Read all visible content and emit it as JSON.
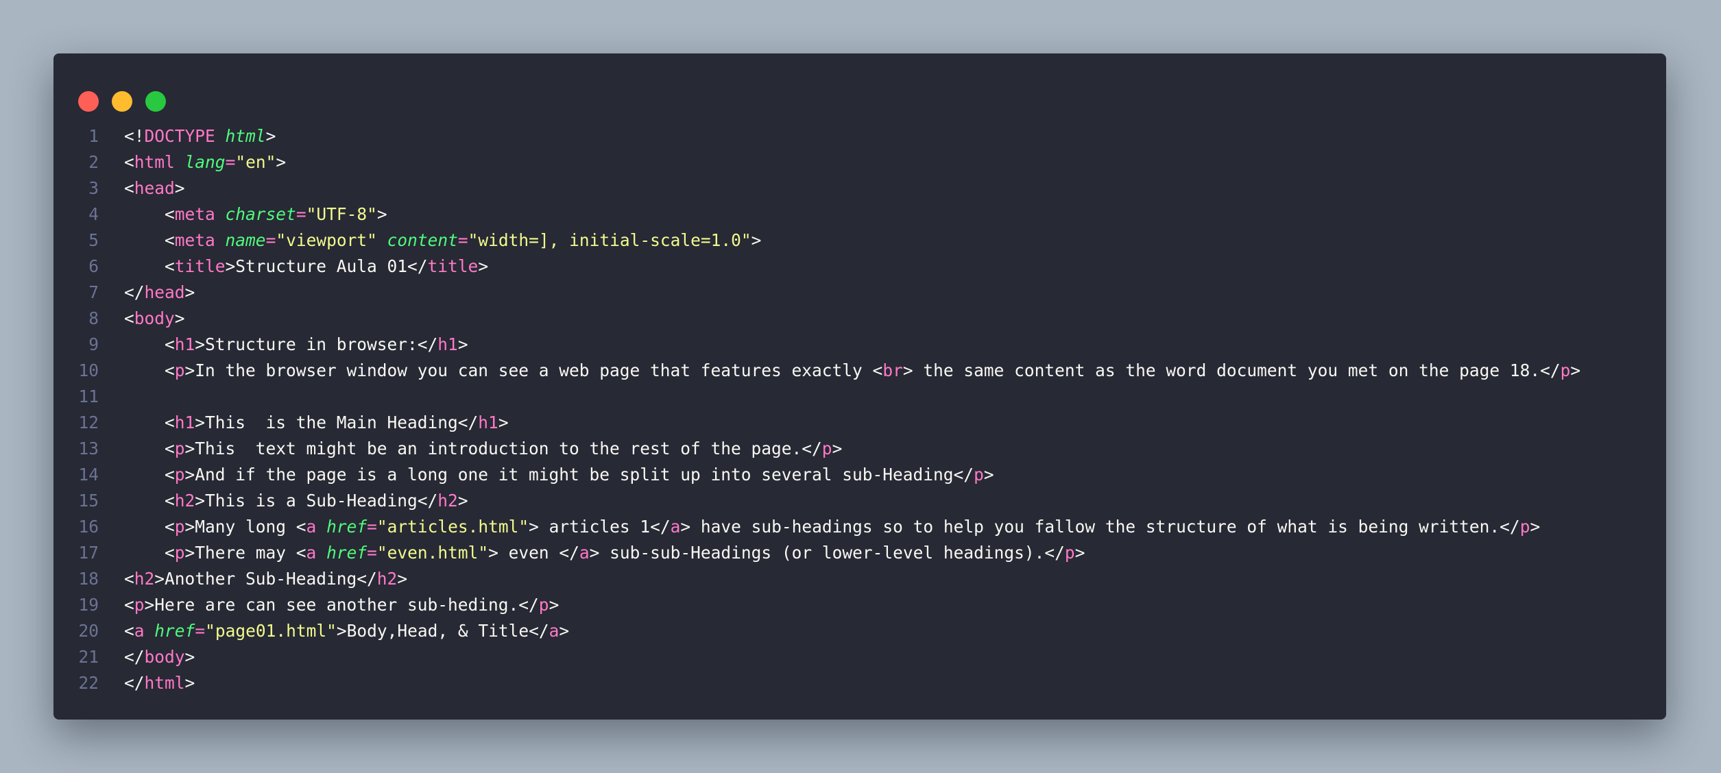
{
  "window": {
    "controls": [
      "close-dot",
      "minimize-dot",
      "maximize-dot"
    ]
  },
  "colors": {
    "background": "#a9b5c1",
    "editor": "#272935",
    "tag": "#ff79c6",
    "attribute": "#50fa7b",
    "string": "#f1fa8c",
    "text": "#f8f8f2",
    "line_number": "#6b7394"
  },
  "lines": [
    {
      "num": "1",
      "tokens": [
        [
          "p",
          "<!"
        ],
        [
          "t",
          "DOCTYPE"
        ],
        [
          "p",
          " "
        ],
        [
          "a",
          "html"
        ],
        [
          "p",
          ">"
        ]
      ]
    },
    {
      "num": "2",
      "tokens": [
        [
          "p",
          "<"
        ],
        [
          "t",
          "html"
        ],
        [
          "p",
          " "
        ],
        [
          "a",
          "lang"
        ],
        [
          "e",
          "="
        ],
        [
          "s",
          "\"en\""
        ],
        [
          "p",
          ">"
        ]
      ]
    },
    {
      "num": "3",
      "tokens": [
        [
          "p",
          "<"
        ],
        [
          "t",
          "head"
        ],
        [
          "p",
          ">"
        ]
      ]
    },
    {
      "num": "4",
      "tokens": [
        [
          "p",
          "    <"
        ],
        [
          "t",
          "meta"
        ],
        [
          "p",
          " "
        ],
        [
          "a",
          "charset"
        ],
        [
          "e",
          "="
        ],
        [
          "s",
          "\"UTF-8\""
        ],
        [
          "p",
          ">"
        ]
      ]
    },
    {
      "num": "5",
      "tokens": [
        [
          "p",
          "    <"
        ],
        [
          "t",
          "meta"
        ],
        [
          "p",
          " "
        ],
        [
          "a",
          "name"
        ],
        [
          "e",
          "="
        ],
        [
          "s",
          "\"viewport\""
        ],
        [
          "p",
          " "
        ],
        [
          "a",
          "content"
        ],
        [
          "e",
          "="
        ],
        [
          "s",
          "\"width=], initial-scale=1.0\""
        ],
        [
          "p",
          ">"
        ]
      ]
    },
    {
      "num": "6",
      "tokens": [
        [
          "p",
          "    <"
        ],
        [
          "t",
          "title"
        ],
        [
          "p",
          ">Structure Aula 01</"
        ],
        [
          "t",
          "title"
        ],
        [
          "p",
          ">"
        ]
      ]
    },
    {
      "num": "7",
      "tokens": [
        [
          "p",
          "</"
        ],
        [
          "t",
          "head"
        ],
        [
          "p",
          ">"
        ]
      ]
    },
    {
      "num": "8",
      "tokens": [
        [
          "p",
          "<"
        ],
        [
          "t",
          "body"
        ],
        [
          "p",
          ">"
        ]
      ]
    },
    {
      "num": "9",
      "tokens": [
        [
          "p",
          "    <"
        ],
        [
          "t",
          "h1"
        ],
        [
          "p",
          ">Structure in browser:</"
        ],
        [
          "t",
          "h1"
        ],
        [
          "p",
          ">"
        ]
      ]
    },
    {
      "num": "10",
      "tokens": [
        [
          "p",
          "    <"
        ],
        [
          "t",
          "p"
        ],
        [
          "p",
          ">In the browser window you can see a web page that features exactly <"
        ],
        [
          "t",
          "br"
        ],
        [
          "p",
          "> the same content as the word document you met on the page 18.</"
        ],
        [
          "t",
          "p"
        ],
        [
          "p",
          ">"
        ]
      ]
    },
    {
      "num": "11",
      "tokens": []
    },
    {
      "num": "12",
      "tokens": [
        [
          "p",
          "    <"
        ],
        [
          "t",
          "h1"
        ],
        [
          "p",
          ">This  is the Main Heading</"
        ],
        [
          "t",
          "h1"
        ],
        [
          "p",
          ">"
        ]
      ]
    },
    {
      "num": "13",
      "tokens": [
        [
          "p",
          "    <"
        ],
        [
          "t",
          "p"
        ],
        [
          "p",
          ">This  text might be an introduction to the rest of the page.</"
        ],
        [
          "t",
          "p"
        ],
        [
          "p",
          ">"
        ]
      ]
    },
    {
      "num": "14",
      "tokens": [
        [
          "p",
          "    <"
        ],
        [
          "t",
          "p"
        ],
        [
          "p",
          ">And if the page is a long one it might be split up into several sub-Heading</"
        ],
        [
          "t",
          "p"
        ],
        [
          "p",
          ">"
        ]
      ]
    },
    {
      "num": "15",
      "tokens": [
        [
          "p",
          "    <"
        ],
        [
          "t",
          "h2"
        ],
        [
          "p",
          ">This is a Sub-Heading</"
        ],
        [
          "t",
          "h2"
        ],
        [
          "p",
          ">"
        ]
      ]
    },
    {
      "num": "16",
      "tokens": [
        [
          "p",
          "    <"
        ],
        [
          "t",
          "p"
        ],
        [
          "p",
          ">Many long <"
        ],
        [
          "t",
          "a"
        ],
        [
          "p",
          " "
        ],
        [
          "a",
          "href"
        ],
        [
          "e",
          "="
        ],
        [
          "s",
          "\"articles.html\""
        ],
        [
          "p",
          "> articles 1</"
        ],
        [
          "t",
          "a"
        ],
        [
          "p",
          "> have sub-headings so to help you fallow the structure of what is being written.</"
        ],
        [
          "t",
          "p"
        ],
        [
          "p",
          ">"
        ]
      ]
    },
    {
      "num": "17",
      "tokens": [
        [
          "p",
          "    <"
        ],
        [
          "t",
          "p"
        ],
        [
          "p",
          ">There may <"
        ],
        [
          "t",
          "a"
        ],
        [
          "p",
          " "
        ],
        [
          "a",
          "href"
        ],
        [
          "e",
          "="
        ],
        [
          "s",
          "\"even.html\""
        ],
        [
          "p",
          "> even </"
        ],
        [
          "t",
          "a"
        ],
        [
          "p",
          "> sub-sub-Headings (or lower-level headings).</"
        ],
        [
          "t",
          "p"
        ],
        [
          "p",
          ">"
        ]
      ]
    },
    {
      "num": "18",
      "tokens": [
        [
          "p",
          "<"
        ],
        [
          "t",
          "h2"
        ],
        [
          "p",
          ">Another Sub-Heading</"
        ],
        [
          "t",
          "h2"
        ],
        [
          "p",
          ">"
        ]
      ]
    },
    {
      "num": "19",
      "tokens": [
        [
          "p",
          "<"
        ],
        [
          "t",
          "p"
        ],
        [
          "p",
          ">Here are can see another sub-heding.</"
        ],
        [
          "t",
          "p"
        ],
        [
          "p",
          ">"
        ]
      ]
    },
    {
      "num": "20",
      "tokens": [
        [
          "p",
          "<"
        ],
        [
          "t",
          "a"
        ],
        [
          "p",
          " "
        ],
        [
          "a",
          "href"
        ],
        [
          "e",
          "="
        ],
        [
          "s",
          "\"page01.html\""
        ],
        [
          "p",
          ">Body,Head, & Title</"
        ],
        [
          "t",
          "a"
        ],
        [
          "p",
          ">"
        ]
      ]
    },
    {
      "num": "21",
      "tokens": [
        [
          "p",
          "</"
        ],
        [
          "t",
          "body"
        ],
        [
          "p",
          ">"
        ]
      ]
    },
    {
      "num": "22",
      "tokens": [
        [
          "p",
          "</"
        ],
        [
          "t",
          "html"
        ],
        [
          "p",
          ">"
        ]
      ]
    }
  ]
}
